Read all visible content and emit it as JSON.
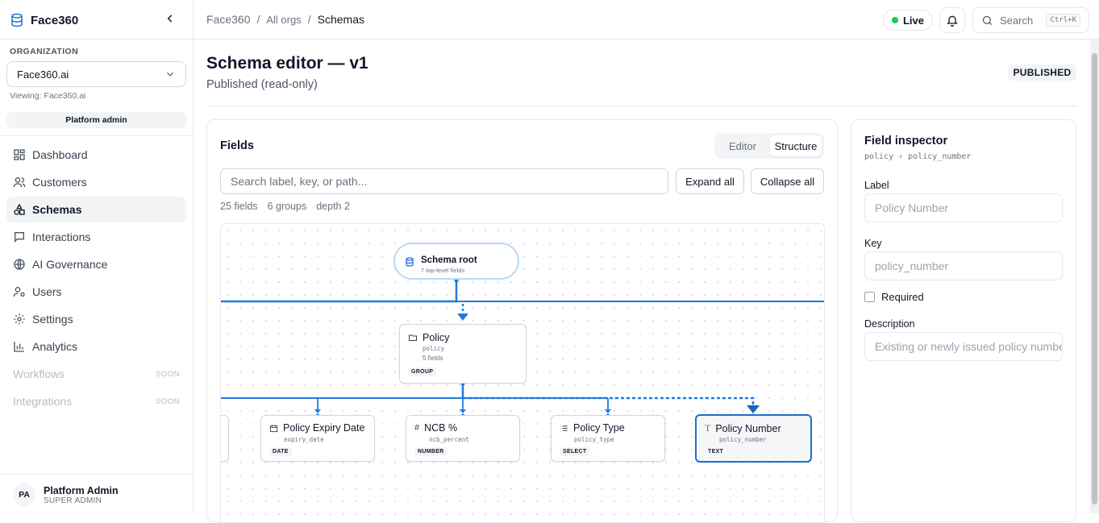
{
  "brand": {
    "name": "Face360"
  },
  "organization": {
    "label": "ORGANIZATION",
    "selected": "Face360.ai",
    "viewing": "Viewing: Face360.ai",
    "role_badge": "Platform admin"
  },
  "nav": {
    "items": [
      {
        "label": "Dashboard",
        "icon": "dashboard-icon"
      },
      {
        "label": "Customers",
        "icon": "users-icon"
      },
      {
        "label": "Schemas",
        "icon": "shapes-icon"
      },
      {
        "label": "Interactions",
        "icon": "message-icon"
      },
      {
        "label": "AI Governance",
        "icon": "globe-icon"
      },
      {
        "label": "Users",
        "icon": "user-cog-icon"
      },
      {
        "label": "Settings",
        "icon": "gear-icon"
      },
      {
        "label": "Analytics",
        "icon": "bar-chart-icon"
      },
      {
        "label": "Workflows",
        "soon": "SOON"
      },
      {
        "label": "Integrations",
        "soon": "SOON"
      }
    ]
  },
  "user": {
    "initials": "PA",
    "name": "Platform Admin",
    "role": "SUPER ADMIN"
  },
  "breadcrumb": [
    "Face360",
    "All orgs",
    "Schemas"
  ],
  "topbar": {
    "live": "Live",
    "search": "Search",
    "shortcut": "Ctrl+K"
  },
  "page": {
    "title": "Schema editor — v1",
    "subtitle": "Published (read-only)",
    "status": "PUBLISHED"
  },
  "fields_panel": {
    "title": "Fields",
    "tabs": [
      "Editor",
      "Structure"
    ],
    "active_tab": "Structure",
    "search_placeholder": "Search label, key, or path...",
    "expand_all": "Expand all",
    "collapse_all": "Collapse all",
    "stats": [
      "25 fields",
      "6 groups",
      "depth 2"
    ]
  },
  "tree": {
    "root": {
      "title": "Schema root",
      "sub": "7 top-level fields"
    },
    "group": {
      "title": "Policy",
      "key": "policy",
      "count": "5 fields",
      "type": "GROUP"
    },
    "children": [
      {
        "title": "Policy Expiry Date",
        "key": "expiry_date",
        "type": "DATE",
        "icon": "calendar-icon"
      },
      {
        "title": "NCB %",
        "key": "ncb_percent",
        "type": "NUMBER",
        "icon": "hash-icon"
      },
      {
        "title": "Policy Type",
        "key": "policy_type",
        "type": "SELECT",
        "icon": "list-icon"
      },
      {
        "title": "Policy Number",
        "key": "policy_number",
        "type": "TEXT",
        "icon": "text-icon"
      }
    ]
  },
  "inspector": {
    "title": "Field inspector",
    "path": "policy › policy_number",
    "label_title": "Label",
    "label_value": "Policy Number",
    "key_title": "Key",
    "key_value": "policy_number",
    "required": "Required",
    "description_title": "Description",
    "description_value": "Existing or newly issued policy number"
  },
  "colors": {
    "accent": "#1d6fd0",
    "live": "#22c55e"
  }
}
